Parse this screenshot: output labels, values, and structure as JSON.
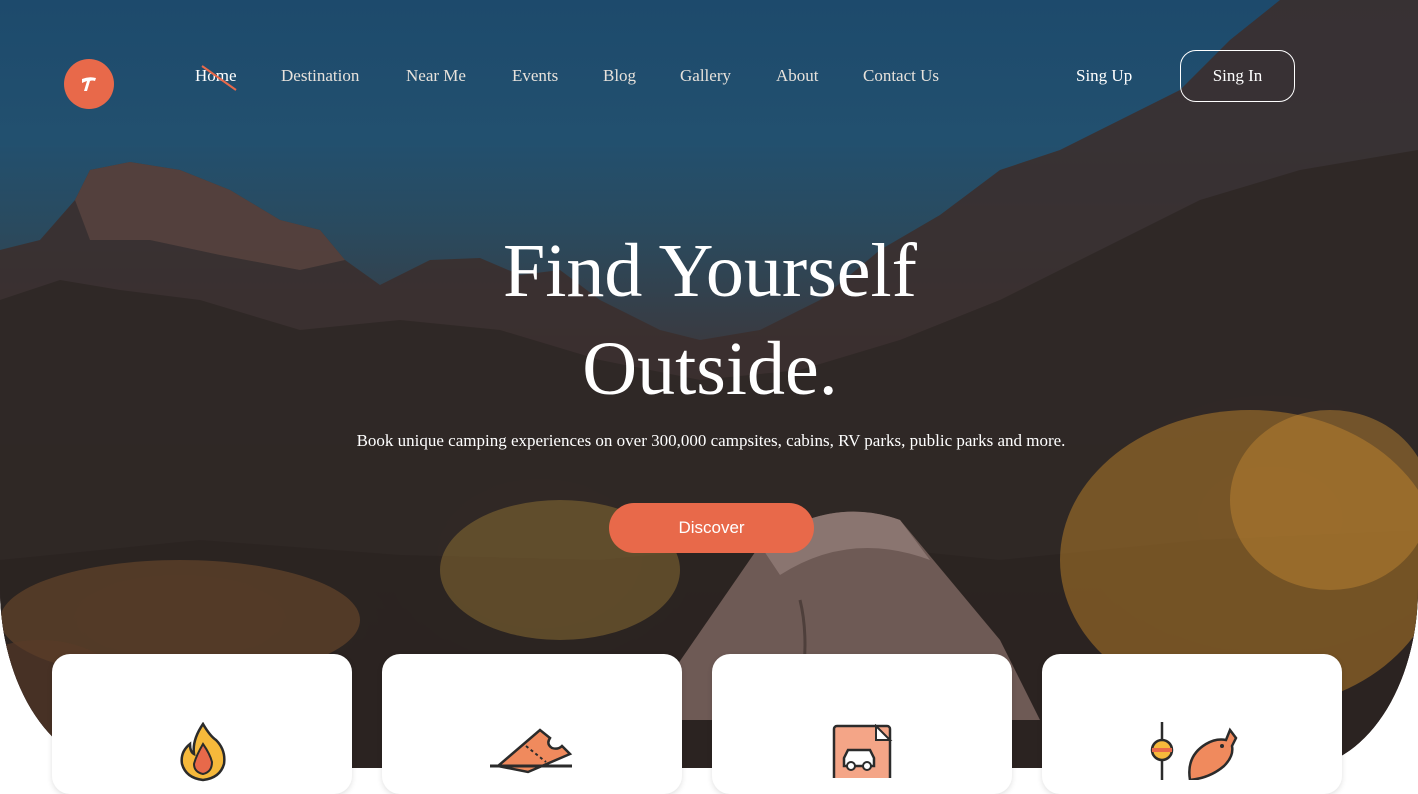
{
  "brand": {
    "logo_letter": "T",
    "accent_color": "#e8694a"
  },
  "nav": {
    "items": [
      {
        "label": "Home",
        "active": true
      },
      {
        "label": "Destination"
      },
      {
        "label": "Near Me"
      },
      {
        "label": "Events"
      },
      {
        "label": "Blog"
      },
      {
        "label": "Gallery"
      },
      {
        "label": "About"
      },
      {
        "label": "Contact Us"
      }
    ],
    "signup_label": "Sing Up",
    "signin_label": "Sing In"
  },
  "hero": {
    "title_line1": "Find Yourself",
    "title_line2": "Outside.",
    "subtitle": "Book unique camping experiences on over 300,000 campsites, cabins, RV parks, public parks and more.",
    "cta_label": "Discover"
  },
  "features": [
    {
      "icon": "campfire-icon"
    },
    {
      "icon": "ticket-icon"
    },
    {
      "icon": "car-document-icon"
    },
    {
      "icon": "fishing-icon"
    }
  ]
}
